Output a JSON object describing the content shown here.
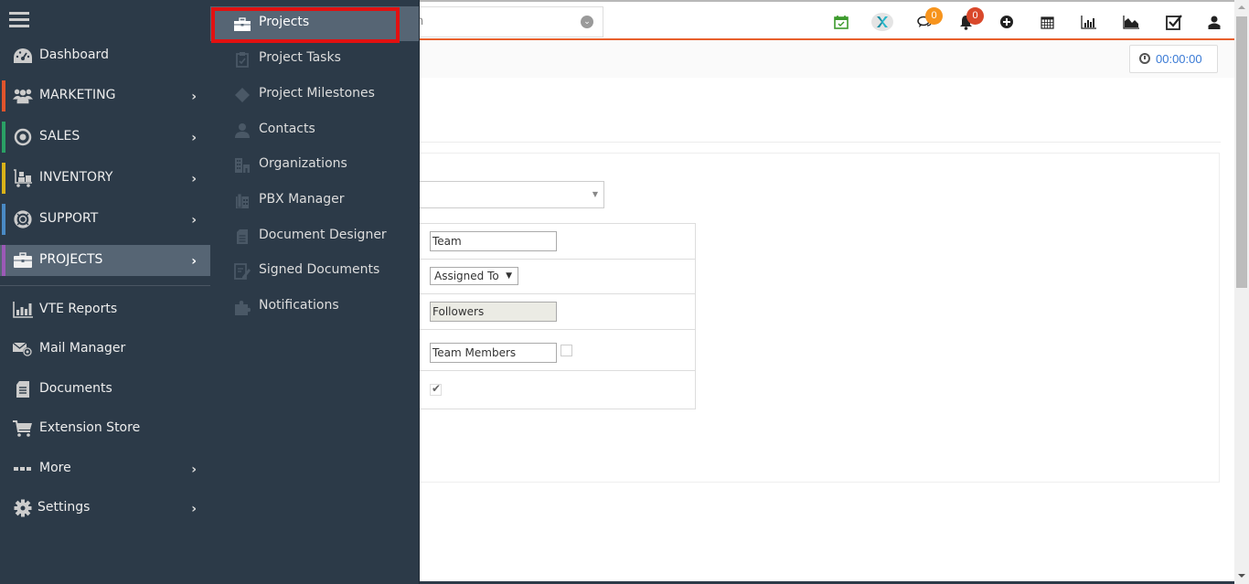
{
  "topbar": {
    "search_text": "h",
    "icons": [
      {
        "name": "calendar-check-icon",
        "color": "#3c9a2c"
      },
      {
        "name": "vte-logo-icon",
        "color": "#1a8fa3"
      },
      {
        "name": "chat-icon",
        "color": "#222222",
        "badge": "0",
        "badge_color": "#f7941d"
      },
      {
        "name": "bell-icon",
        "color": "#222222",
        "badge": "0",
        "badge_color": "#d9482b"
      },
      {
        "name": "plus-circle-icon",
        "color": "#222222"
      },
      {
        "name": "calendar-icon",
        "color": "#222222"
      },
      {
        "name": "bar-chart-icon",
        "color": "#222222"
      },
      {
        "name": "area-chart-icon",
        "color": "#222222"
      },
      {
        "name": "checkbox-icon",
        "color": "#222222"
      },
      {
        "name": "user-icon",
        "color": "#222222"
      }
    ]
  },
  "subbar": {
    "timer": "00:00:00"
  },
  "form": {
    "rows": [
      {
        "type": "input",
        "value": "Team"
      },
      {
        "type": "select",
        "value": "Assigned To"
      },
      {
        "type": "input-disabled",
        "value": "Followers"
      },
      {
        "type": "input-check",
        "value": "Team Members",
        "checked": false
      },
      {
        "type": "check",
        "checked": true
      }
    ]
  },
  "sidebar": {
    "items": [
      {
        "label": "Dashboard",
        "icon": "dashboard-icon",
        "arrow": false,
        "accent": null
      },
      {
        "label": "MARKETING",
        "icon": "users-icon",
        "arrow": true,
        "accent": "#e0542c"
      },
      {
        "label": "SALES",
        "icon": "target-icon",
        "arrow": true,
        "accent": "#2aa065"
      },
      {
        "label": "INVENTORY",
        "icon": "cart-dolly-icon",
        "arrow": true,
        "accent": "#d9b219"
      },
      {
        "label": "SUPPORT",
        "icon": "lifebuoy-icon",
        "arrow": true,
        "accent": "#4a8ac4"
      },
      {
        "label": "PROJECTS",
        "icon": "briefcase-icon",
        "arrow": true,
        "accent": "#9b59b6",
        "active": true
      },
      {
        "label": "VTE Reports",
        "icon": "bar-chart-icon",
        "arrow": false
      },
      {
        "label": "Mail Manager",
        "icon": "mail-at-icon",
        "arrow": false
      },
      {
        "label": "Documents",
        "icon": "document-icon",
        "arrow": false
      },
      {
        "label": "Extension Store",
        "icon": "cart-icon",
        "arrow": false
      },
      {
        "label": "More",
        "icon": "ellipsis-icon",
        "arrow": true
      },
      {
        "label": "Settings",
        "icon": "gear-icon",
        "arrow": true
      }
    ]
  },
  "submenu": {
    "items": [
      {
        "label": "Projects",
        "icon": "briefcase-icon",
        "active": true
      },
      {
        "label": "Project Tasks",
        "icon": "clipboard-check-icon"
      },
      {
        "label": "Project Milestones",
        "icon": "diamond-icon"
      },
      {
        "label": "Contacts",
        "icon": "person-icon"
      },
      {
        "label": "Organizations",
        "icon": "building-icon"
      },
      {
        "label": "PBX Manager",
        "icon": "phone-office-icon"
      },
      {
        "label": "Document Designer",
        "icon": "file-text-icon"
      },
      {
        "label": "Signed Documents",
        "icon": "file-signature-icon"
      },
      {
        "label": "Notifications",
        "icon": "puzzle-icon"
      }
    ]
  }
}
